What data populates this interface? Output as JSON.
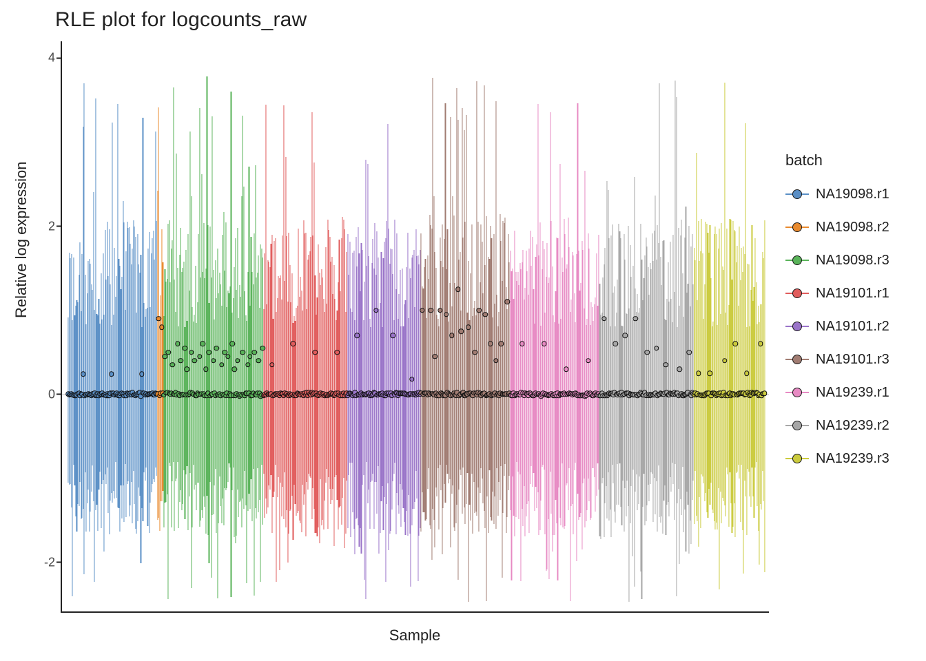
{
  "chart_data": {
    "type": "boxplot-rle",
    "title": "RLE plot for logcounts_raw",
    "xlabel": "Sample",
    "ylabel": "Relative log expression",
    "legend_title": "batch",
    "ylim": [
      -2.6,
      4.2
    ],
    "yticks": [
      -2,
      0,
      2,
      4
    ],
    "batches": [
      {
        "name": "NA19098.r1",
        "color": "#5A8FC6",
        "n": 85
      },
      {
        "name": "NA19098.r2",
        "color": "#E98A2E",
        "n": 6
      },
      {
        "name": "NA19098.r3",
        "color": "#59B359",
        "n": 95
      },
      {
        "name": "NA19101.r1",
        "color": "#E15C5C",
        "n": 80
      },
      {
        "name": "NA19101.r2",
        "color": "#9A74C9",
        "n": 70
      },
      {
        "name": "NA19101.r3",
        "color": "#A17C72",
        "n": 85
      },
      {
        "name": "NA19239.r1",
        "color": "#E78AC3",
        "n": 85
      },
      {
        "name": "NA19239.r2",
        "color": "#A7A7A7",
        "n": 90
      },
      {
        "name": "NA19239.r3",
        "color": "#CBCB3D",
        "n": 68
      }
    ],
    "whisker_range_typical": [
      -1.5,
      1.5
    ],
    "whisker_range_spread": [
      -2.4,
      3.8
    ],
    "note": "Per-sample RLE (relative log expression) boxplots, ~660 samples across 9 batches. Medians are ~0 for most samples; a subset (mostly in NA19098.r2/r3, NA19101.r3, NA19239.r2) have medians 0.2–1.0. Whiskers span roughly ±1.5 with some samples reaching ≈3.8 above and ≈−2.4 below.",
    "representative_outlier_medians": {
      "NA19098.r1": [
        0.24,
        0.24,
        0.24
      ],
      "NA19098.r2": [
        0.9,
        0.8
      ],
      "NA19098.r3": [
        0.45,
        0.5,
        0.35,
        0.6,
        0.4,
        0.55,
        0.3,
        0.5,
        0.4,
        0.45,
        0.6,
        0.3,
        0.5,
        0.4,
        0.55,
        0.35,
        0.5,
        0.45,
        0.6,
        0.3,
        0.4,
        0.5,
        0.35,
        0.45,
        0.5,
        0.4,
        0.55
      ],
      "NA19101.r1": [
        0.35,
        0.6,
        0.5,
        0.5
      ],
      "NA19101.r2": [
        0.7,
        1.0,
        0.7,
        0.18
      ],
      "NA19101.r3": [
        1.0,
        1.0,
        0.45,
        1.0,
        0.95,
        0.7,
        1.25,
        0.75,
        0.8,
        0.5,
        1.0,
        0.95,
        0.6,
        0.4,
        0.6,
        1.1
      ],
      "NA19239.r1": [
        0.6,
        0.6,
        0.3,
        0.4
      ],
      "NA19239.r2": [
        0.9,
        0.6,
        0.7,
        0.9,
        0.5,
        0.55,
        0.35,
        0.3,
        0.5
      ],
      "NA19239.r3": [
        0.25,
        0.25,
        0.4,
        0.6,
        0.25,
        0.6
      ]
    }
  }
}
